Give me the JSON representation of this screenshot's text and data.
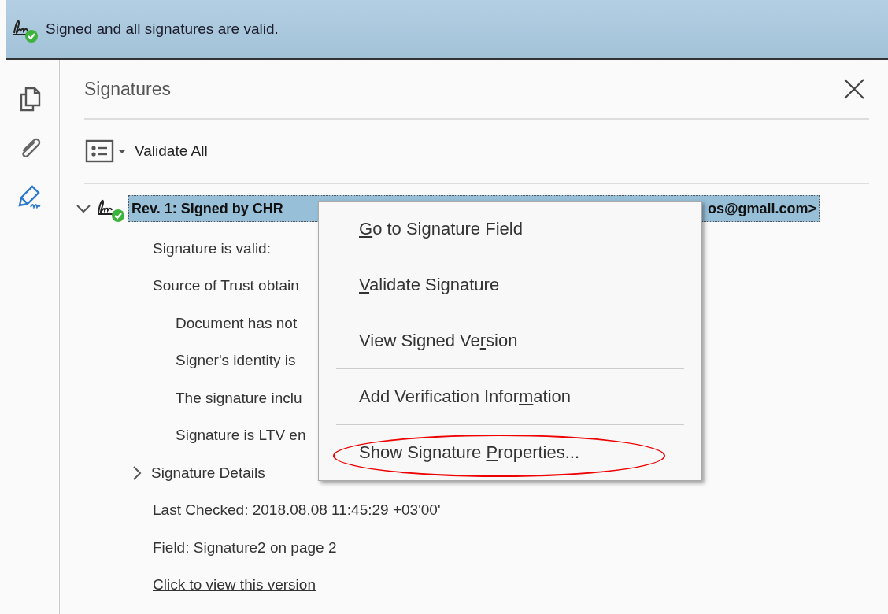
{
  "banner": {
    "text": "Signed and all signatures are valid."
  },
  "rail": [
    {
      "kind": "pages",
      "selected": false
    },
    {
      "kind": "attachments",
      "selected": false
    },
    {
      "kind": "signatures",
      "selected": true
    }
  ],
  "panel": {
    "title": "Signatures",
    "toolbar_button": "Validate All"
  },
  "signature": {
    "expanded": true,
    "selected": true,
    "heading_start": "Rev. 1: Signed by CHR",
    "heading_end": "os@gmail.com>",
    "lines": [
      {
        "text": "Signature is valid:",
        "indent": false
      },
      {
        "text": "Source of Trust obtain",
        "indent": false
      },
      {
        "text": "Document has not",
        "indent": true
      },
      {
        "text": "Signer's identity is",
        "indent": true
      },
      {
        "text": "The signature inclu",
        "indent": true
      },
      {
        "text": "Signature is LTV en",
        "indent": true
      }
    ],
    "details": {
      "label": "Signature Details",
      "expanded": false
    },
    "last_checked": "Last Checked: 2018.08.08 11:45:29 +03'00'",
    "field": "Field: Signature2 on page 2",
    "link": "Click to view this version"
  },
  "context_menu": [
    {
      "key": "G",
      "after": "o to Signature Field",
      "circled": false
    },
    {
      "key": "V",
      "after": "alidate Signature",
      "circled": false
    },
    {
      "before": "View Signed Ve",
      "key": "r",
      "after": "sion",
      "circled": false
    },
    {
      "before": "Add Verification Infor",
      "key": "m",
      "after": "ation",
      "circled": false
    },
    {
      "before": "Show Signature ",
      "key": "P",
      "after": "roperties...",
      "circled": true
    }
  ]
}
